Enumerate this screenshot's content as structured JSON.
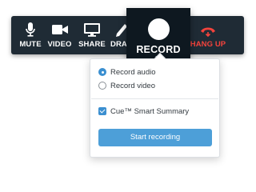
{
  "toolbar": {
    "mute_label": "MUTE",
    "video_label": "VIDEO",
    "share_label": "SHARE",
    "draw_label": "DRAW",
    "hangup_label": "HANG UP",
    "record_label": "RECORD"
  },
  "icons": {
    "mute": "microphone-icon",
    "video": "video-camera-icon",
    "share": "monitor-icon",
    "draw": "pencil-icon",
    "hangup": "phone-hangup-icon",
    "record": "record-dot-icon"
  },
  "record_menu": {
    "options": [
      {
        "label": "Record audio",
        "selected": true
      },
      {
        "label": "Record video",
        "selected": false
      }
    ],
    "summary_label": "Cue™ Smart Summary",
    "summary_checked": true,
    "start_button": "Start recording"
  },
  "colors": {
    "toolbar_bg": "#1f2b35",
    "record_bg": "#0e1820",
    "accent": "#3b8fd0",
    "hangup_red": "#f4433c"
  }
}
